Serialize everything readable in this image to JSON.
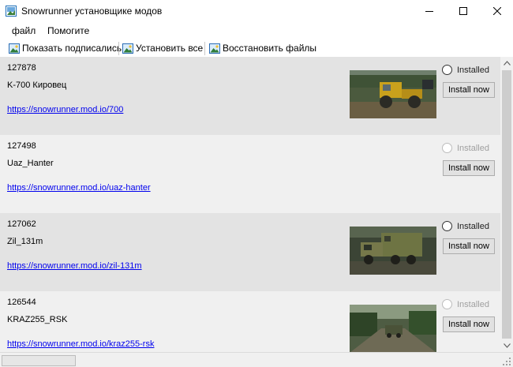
{
  "window": {
    "title": "Snowrunner установщике модов"
  },
  "menu": {
    "items": [
      "файл",
      "Помогите"
    ]
  },
  "toolbar": {
    "show_subscribed": "Показать подписались",
    "install_all": "Установить все",
    "restore_files": "Восстановить файлы"
  },
  "mods": [
    {
      "id": "127878",
      "name": "K-700 Кировец",
      "link": "https://snowrunner.mod.io/700",
      "installed_label": "Installed",
      "installed": false,
      "radio_enabled": true,
      "install_label": "Install now",
      "has_thumbnail": true,
      "thumbnail": "yellow-tractor-image"
    },
    {
      "id": "127498",
      "name": "Uaz_Hanter",
      "link": "https://snowrunner.mod.io/uaz-hanter",
      "installed_label": "Installed",
      "installed": false,
      "radio_enabled": false,
      "install_label": "Install now",
      "has_thumbnail": false
    },
    {
      "id": "127062",
      "name": "Zil_131m",
      "link": "https://snowrunner.mod.io/zil-131m",
      "installed_label": "Installed",
      "installed": false,
      "radio_enabled": true,
      "install_label": "Install now",
      "has_thumbnail": true,
      "thumbnail": "green-army-truck-image"
    },
    {
      "id": "126544",
      "name": "KRAZ255_RSK",
      "link": "https://snowrunner.mod.io/kraz255-rsk",
      "installed_label": "Installed",
      "installed": false,
      "radio_enabled": false,
      "install_label": "Install now",
      "has_thumbnail": true,
      "thumbnail": "truck-in-forest-image"
    }
  ],
  "colors": {
    "link": "#0000ee",
    "row_dark": "#e3e3e3",
    "row_light": "#f0f0f0",
    "button_face": "#e1e1e1"
  }
}
